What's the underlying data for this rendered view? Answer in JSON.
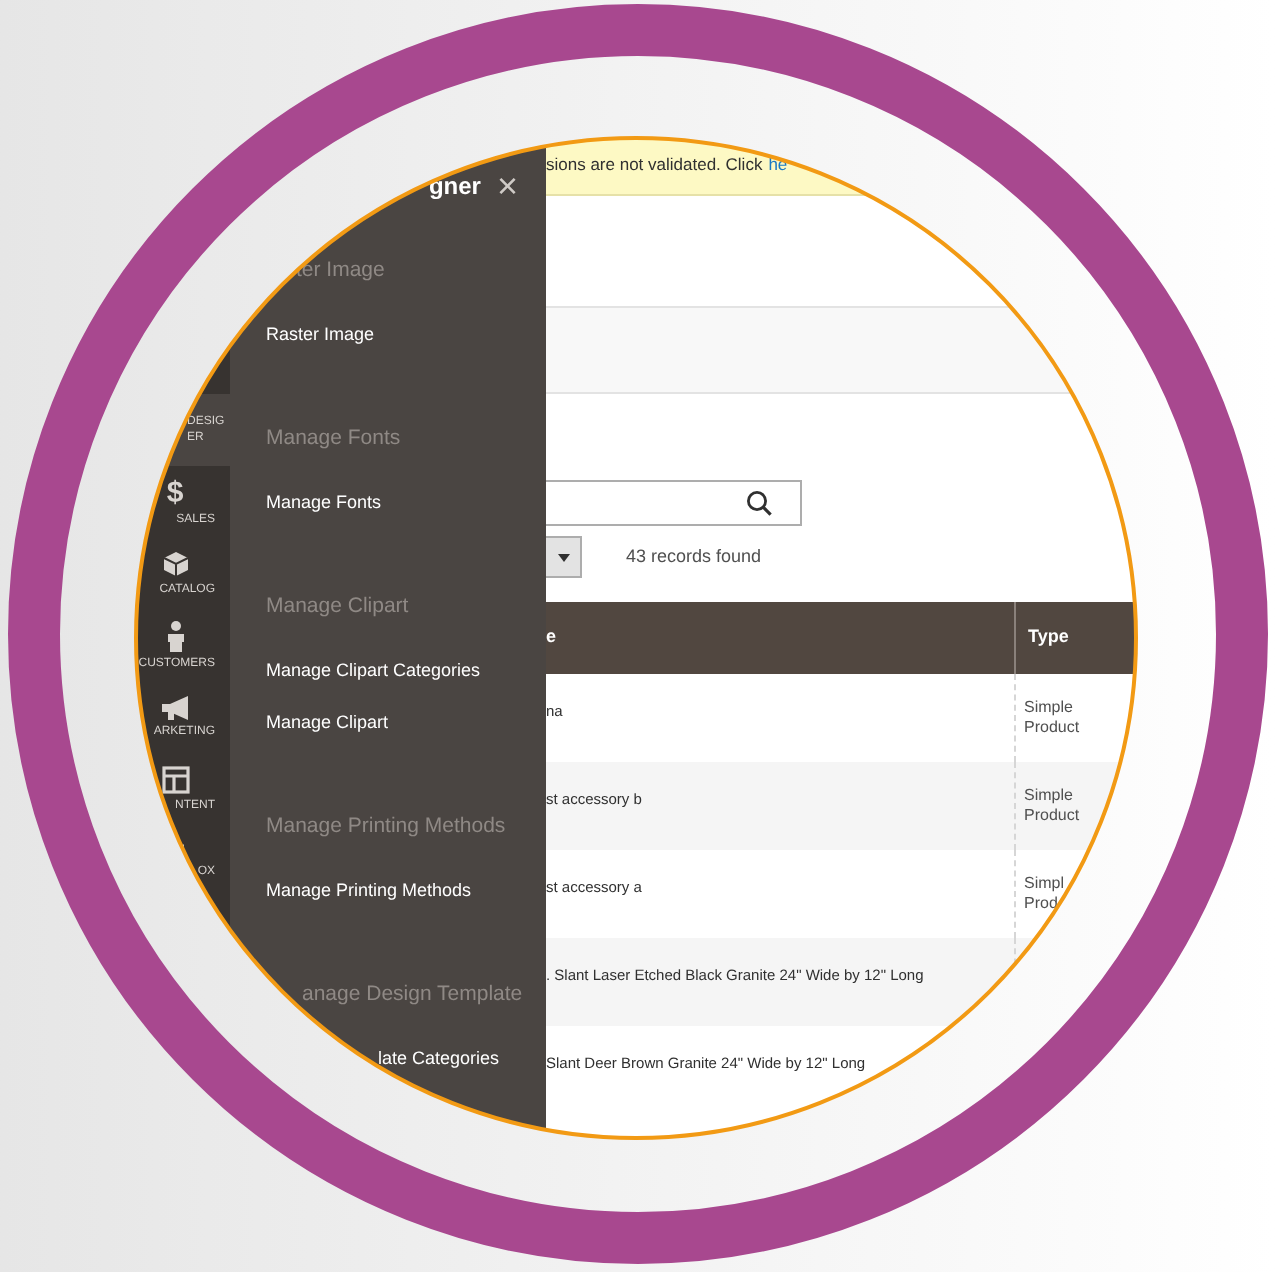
{
  "admin_nav": {
    "items": [
      {
        "label": "DESIG ER",
        "selected": true
      },
      {
        "label": "SALES",
        "selected": false,
        "icon_text": "$"
      },
      {
        "label": "CATALOG",
        "selected": false
      },
      {
        "label": "CUSTOMERS",
        "selected": false
      },
      {
        "label": "ARKETING",
        "selected": false
      },
      {
        "label": "NTENT",
        "selected": false
      },
      {
        "label": "OX",
        "selected": false
      }
    ]
  },
  "flyout": {
    "title": "gner",
    "close": "×",
    "sections": [
      {
        "heading": "ter Image",
        "items": [
          "Raster Image"
        ]
      },
      {
        "heading": "Manage Fonts",
        "items": [
          "Manage Fonts"
        ]
      },
      {
        "heading": "Manage Clipart",
        "items": [
          "Manage Clipart Categories",
          "Manage Clipart"
        ]
      },
      {
        "heading": "Manage Printing Methods",
        "items": [
          "Manage Printing Methods"
        ]
      },
      {
        "heading": "anage Design Template",
        "items": [
          "late Categories"
        ]
      }
    ]
  },
  "notice": {
    "text": "sions are not validated. Click",
    "link": "he"
  },
  "records": "43 records found",
  "table": {
    "columns": [
      "e",
      "Type"
    ],
    "rows": [
      [
        "na",
        "Simple Product"
      ],
      [
        "st accessory b",
        "Simple Product"
      ],
      [
        "st accessory a",
        "Simpl Prod"
      ],
      [
        ". Slant Laser Etched Black Granite 24\" Wide by 12\" Long",
        ""
      ],
      [
        "Slant Deer Brown Granite 24\" Wide by 12\" Long",
        ""
      ]
    ]
  }
}
